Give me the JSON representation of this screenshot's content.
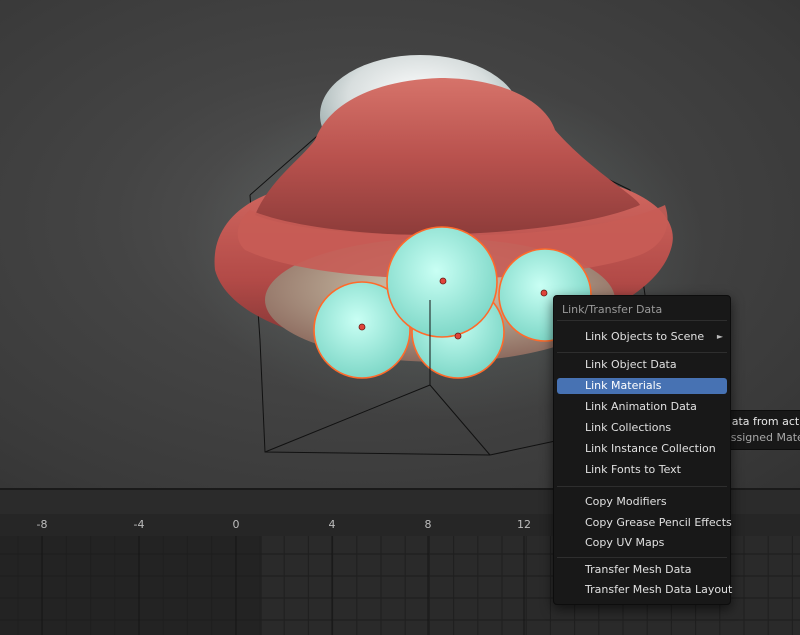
{
  "menu": {
    "title": "Link/Transfer Data",
    "items": [
      {
        "label": "Link Objects to Scene",
        "submenu": true
      },
      {
        "label": "Link Object Data"
      },
      {
        "label": "Link Materials",
        "active": true
      },
      {
        "label": "Link Animation Data"
      },
      {
        "label": "Link Collections"
      },
      {
        "label": "Link Instance Collection"
      },
      {
        "label": "Link Fonts to Text"
      },
      {
        "label": "Copy Modifiers"
      },
      {
        "label": "Copy Grease Pencil Effects"
      },
      {
        "label": "Copy UV Maps"
      },
      {
        "label": "Transfer Mesh Data"
      },
      {
        "label": "Transfer Mesh Data Layout"
      }
    ],
    "submenu_arrow": "►"
  },
  "tooltip": {
    "line1": "Transfer data from active",
    "line2": "Replace assigned Material"
  },
  "timeline": {
    "ticks": [
      "-8",
      "-4",
      "0",
      "4",
      "8",
      "12"
    ]
  },
  "colors": {
    "accent": "#4772b3",
    "selection_outline": "#ff6a2a",
    "hull": "#c2524e",
    "lights": "#a9ece0"
  }
}
